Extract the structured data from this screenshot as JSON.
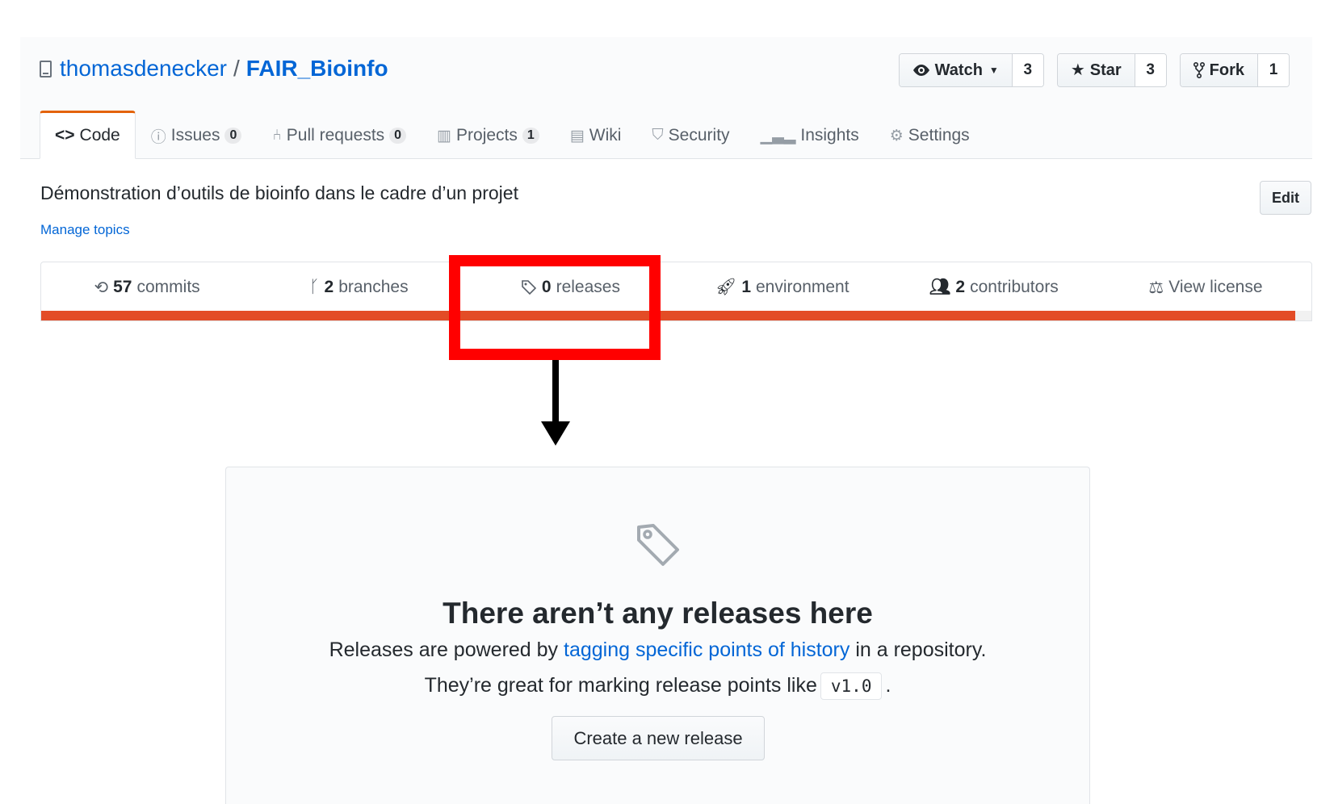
{
  "repo": {
    "owner": "thomasdenecker",
    "separator": "/",
    "name": "FAIR_Bioinfo",
    "icon": "repo-icon"
  },
  "actions": {
    "watch": {
      "label": "Watch",
      "count": "3",
      "icon": "eye-icon"
    },
    "star": {
      "label": "Star",
      "count": "3",
      "icon": "star-icon"
    },
    "fork": {
      "label": "Fork",
      "count": "1",
      "icon": "fork-icon"
    }
  },
  "nav": {
    "tabs": [
      {
        "label": "Code",
        "icon": "code-icon",
        "counter": null,
        "selected": true
      },
      {
        "label": "Issues",
        "icon": "issue-icon",
        "counter": "0"
      },
      {
        "label": "Pull requests",
        "icon": "pull-request-icon",
        "counter": "0"
      },
      {
        "label": "Projects",
        "icon": "project-icon",
        "counter": "1"
      },
      {
        "label": "Wiki",
        "icon": "book-icon",
        "counter": null
      },
      {
        "label": "Security",
        "icon": "shield-icon",
        "counter": null
      },
      {
        "label": "Insights",
        "icon": "graph-icon",
        "counter": null
      },
      {
        "label": "Settings",
        "icon": "gear-icon",
        "counter": null
      }
    ]
  },
  "description": {
    "text": "Démonstration d’outils de bioinfo dans le cadre d’un projet",
    "manage_topics": "Manage topics",
    "edit_label": "Edit"
  },
  "summary": {
    "commits": {
      "num": "57",
      "label": "commits",
      "icon": "history-icon"
    },
    "branches": {
      "num": "2",
      "label": "branches",
      "icon": "branch-icon"
    },
    "releases": {
      "num": "0",
      "label": "releases",
      "icon": "tag-icon"
    },
    "environments": {
      "num": "1",
      "label": "environment",
      "icon": "rocket-icon"
    },
    "contributors": {
      "num": "2",
      "label": "contributors",
      "icon": "people-icon"
    },
    "license": {
      "label": "View license",
      "icon": "law-icon"
    },
    "language_bar_fill": 0.987,
    "language_color": "#e34c26"
  },
  "annotation": {
    "highlight_color": "#ff0000",
    "arrow_color": "#000000"
  },
  "blankslate": {
    "icon": "tag-icon",
    "title": "There aren’t any releases here",
    "line1_pre": "Releases are powered by",
    "line1_link": "tagging specific points of history",
    "line1_post": "in a repository.",
    "line2_pre": "They’re great for marking release points like",
    "line2_code": "v1.0",
    "line2_post": ".",
    "button": "Create a new release"
  },
  "colors": {
    "link": "#0366d6",
    "accent_tab": "#e36209"
  }
}
